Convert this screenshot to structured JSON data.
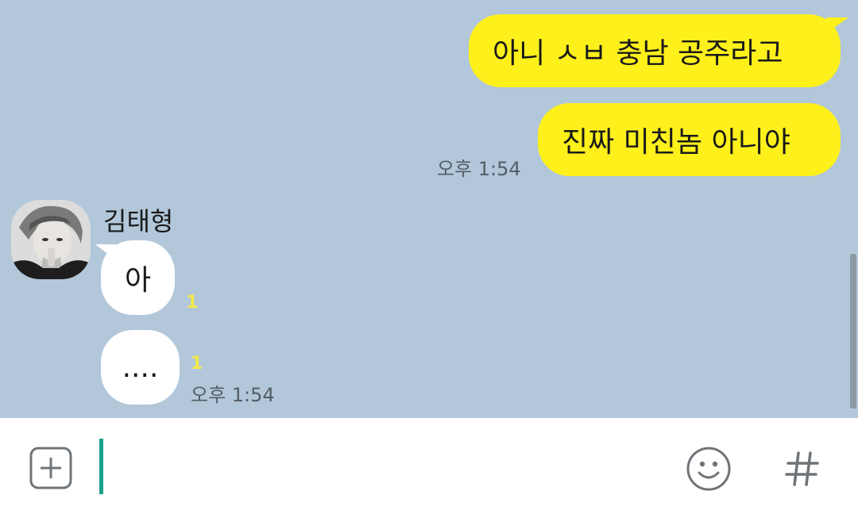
{
  "messages_out": [
    {
      "text": "아니 ㅅㅂ 충남 공주라고"
    },
    {
      "text": "진짜 미친놈 아니야"
    }
  ],
  "out_time": "오후 1:54",
  "sender_name": "김태형",
  "messages_in": [
    {
      "text": "아",
      "unread": "1"
    },
    {
      "text": "....",
      "unread": "1"
    }
  ],
  "in_time": "오후 1:54",
  "input": {
    "value": ""
  },
  "icons": {
    "attach": "plus-square-icon",
    "emoji": "smiley-icon",
    "hashtag": "hash-icon"
  },
  "colors": {
    "chat_background": "#b2c7da",
    "outgoing_bubble": "#fef01b",
    "incoming_bubble": "#ffffff",
    "caret": "#1aa08a",
    "unread_count": "#f3e84a"
  }
}
